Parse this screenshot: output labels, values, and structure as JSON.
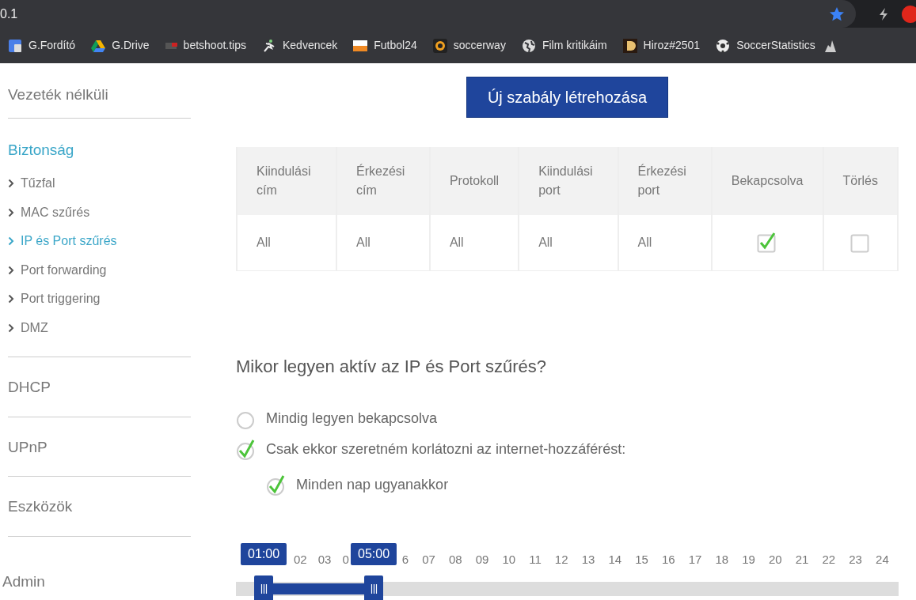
{
  "browser": {
    "address": "0.1",
    "starred": true,
    "bookmarks": [
      {
        "label": "G.Fordító",
        "kind": "translate"
      },
      {
        "label": "G.Drive",
        "kind": "drive"
      },
      {
        "label": "betshoot.tips",
        "kind": "bet"
      },
      {
        "label": "Kedvencek",
        "kind": "runner"
      },
      {
        "label": "Futbol24",
        "kind": "f24"
      },
      {
        "label": "soccerway",
        "kind": "ball"
      },
      {
        "label": "Film kritikáim",
        "kind": "globe"
      },
      {
        "label": "Hiroz#2501",
        "kind": "d"
      },
      {
        "label": "SoccerStatistics",
        "kind": "soccer"
      }
    ]
  },
  "sidebar": {
    "sections": [
      {
        "label": "Vezeték nélküli",
        "selected": false
      },
      {
        "label": "Biztonság",
        "selected": true,
        "items": [
          {
            "label": "Tűzfal",
            "selected": false
          },
          {
            "label": "MAC szűrés",
            "selected": false
          },
          {
            "label": "IP és Port szűrés",
            "selected": true
          },
          {
            "label": "Port forwarding",
            "selected": false
          },
          {
            "label": "Port triggering",
            "selected": false
          },
          {
            "label": "DMZ",
            "selected": false
          }
        ]
      },
      {
        "label": "DHCP",
        "selected": false
      },
      {
        "label": "UPnP",
        "selected": false
      },
      {
        "label": "Eszközök",
        "selected": false
      },
      {
        "label": "Admin",
        "selected": false
      }
    ]
  },
  "new_rule_button": "Új szabály létrehozása",
  "table": {
    "columns": [
      "Kiindulási cím",
      "Érkezési cím",
      "Protokoll",
      "Kiindulási port",
      "Érkezési port",
      "Bekapcsolva",
      "Törlés"
    ],
    "rows": [
      {
        "cells": [
          "All",
          "All",
          "All",
          "All",
          "All"
        ],
        "enabled": true,
        "delete": false
      }
    ]
  },
  "schedule": {
    "question": "Mikor legyen aktív az IP és Port szűrés?",
    "options": [
      {
        "label": "Mindig legyen bekapcsolva",
        "selected": false
      },
      {
        "label": "Csak ekkor szeretném korlátozni az internet-hozzáférést:",
        "selected": true
      }
    ],
    "every_day": {
      "label": "Minden nap ugyanakkor",
      "checked": true
    },
    "ticks": [
      "02",
      "03",
      "0",
      "6",
      "07",
      "08",
      "09",
      "10",
      "11",
      "12",
      "13",
      "14",
      "15",
      "16",
      "17",
      "18",
      "19",
      "20",
      "21",
      "22",
      "23",
      "24"
    ],
    "handles": [
      {
        "label": "01:00",
        "level": 0.042
      },
      {
        "label": "05:00",
        "level": 0.208
      }
    ]
  }
}
